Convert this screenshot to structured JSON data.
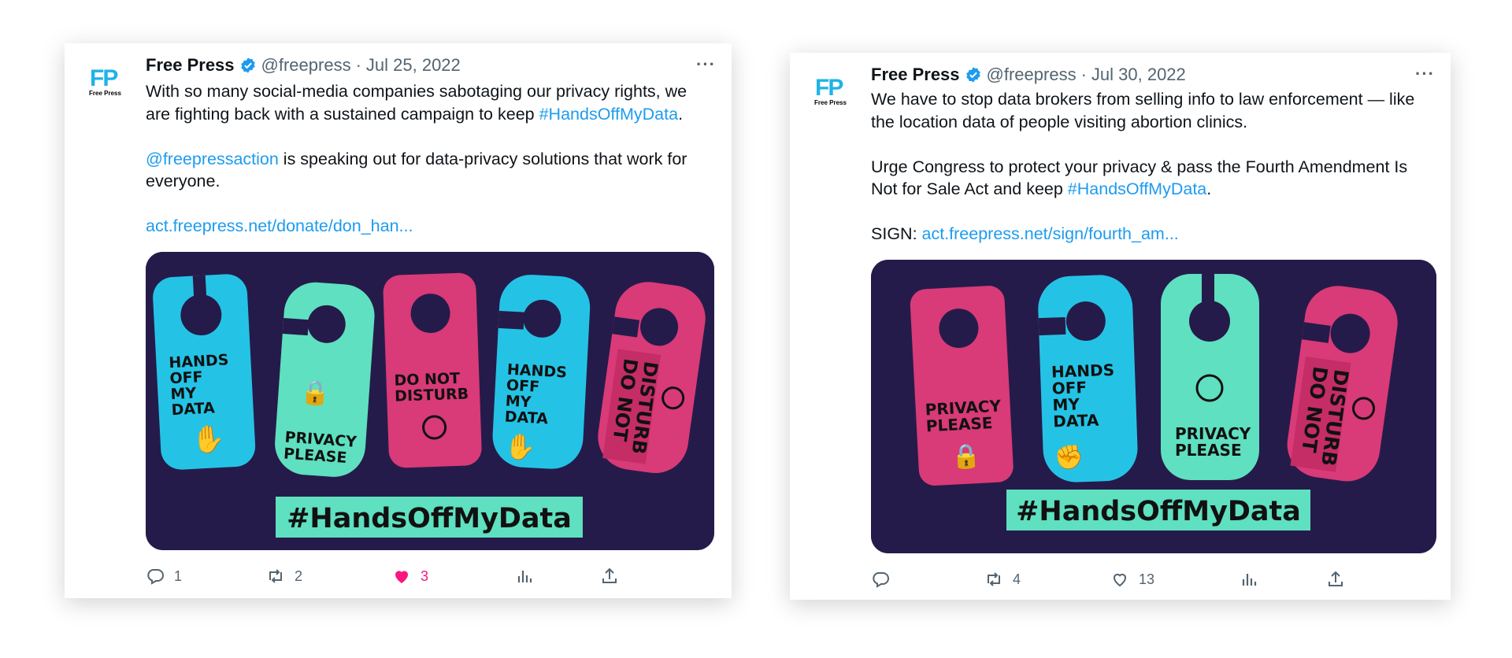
{
  "colors": {
    "brand": "#1fb3e6",
    "link": "#1d9bf0",
    "like": "#f91880",
    "muted": "#536471",
    "media_bg": "#251b4a",
    "tag_cyan": "#24c3e6",
    "tag_mint": "#5fe0c0",
    "tag_pink": "#d93a78"
  },
  "tweets": [
    {
      "avatar": {
        "logo": "FP",
        "sub": "Free Press"
      },
      "author": "Free Press",
      "verified_icon": "verified-badge-icon",
      "handle": "@freepress",
      "separator": "·",
      "date": "Jul 25, 2022",
      "more": "···",
      "body": {
        "p1_text": "With so many social-media companies sabotaging our privacy rights, we are fighting back with a sustained campaign to keep ",
        "p1_link": "#HandsOffMyData",
        "p1_end": ".",
        "p2_link": "@freepressaction",
        "p2_text": " is speaking out for data-privacy solutions that work for everyone.",
        "p3_link": "act.freepress.net/donate/don_han..."
      },
      "media": {
        "hashtag": "#HandsOffMyData",
        "tags": [
          {
            "text": [
              "HANDS",
              "OFF",
              "MY",
              "DATA"
            ],
            "icon": "hand-icon"
          },
          {
            "text": [
              "PRIVACY",
              "PLEASE"
            ],
            "icon": "lock-icon"
          },
          {
            "text": [
              "DO NOT",
              "DISTURB"
            ],
            "icon": "globe-cursor-icon"
          },
          {
            "text": [
              "HANDS",
              "OFF",
              "MY",
              "DATA"
            ],
            "icon": "hand-icon"
          },
          {
            "text": [
              "DO NOT",
              "DISTURB"
            ],
            "icon": "globe-cursor-icon"
          }
        ]
      },
      "actions": {
        "reply": "1",
        "retweet": "2",
        "like": "3",
        "like_active": true
      }
    },
    {
      "avatar": {
        "logo": "FP",
        "sub": "Free Press"
      },
      "author": "Free Press",
      "verified_icon": "verified-badge-icon",
      "handle": "@freepress",
      "separator": "·",
      "date": "Jul 30, 2022",
      "more": "···",
      "body": {
        "p1_text": "We have to stop data brokers from selling info to law enforcement — like the location data of people visiting abortion clinics.",
        "p2_text": "Urge Congress to protect your privacy & pass the Fourth Amendment Is Not for Sale Act and keep ",
        "p2_link": "#HandsOffMyData",
        "p2_end": ".",
        "p3_text": "SIGN: ",
        "p3_link": "act.freepress.net/sign/fourth_am..."
      },
      "media": {
        "hashtag": "#HandsOffMyData",
        "tags": [
          {
            "text": [
              "PRIVACY",
              "PLEASE"
            ],
            "icon": "lock-icon"
          },
          {
            "text": [
              "HANDS",
              "OFF",
              "MY",
              "DATA"
            ],
            "icon": "fist-icon"
          },
          {
            "text": [
              "PRIVACY",
              "PLEASE"
            ],
            "icon": "uterus-icon"
          },
          {
            "text": [
              "DO NOT",
              "DISTURB"
            ],
            "icon": "globe-cursor-icon"
          }
        ]
      },
      "actions": {
        "reply": "",
        "retweet": "4",
        "like": "13",
        "like_active": false
      }
    }
  ]
}
